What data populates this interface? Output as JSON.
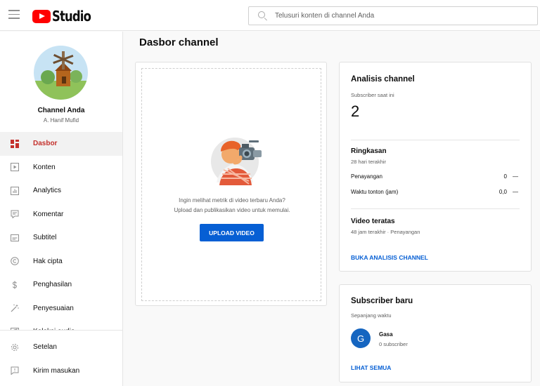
{
  "header": {
    "logo_text": "Studio",
    "search_placeholder": "Telusuri konten di channel Anda"
  },
  "sidebar": {
    "channel_name": "Channel Anda",
    "channel_owner": "A. Hanif Mufid",
    "items": [
      {
        "label": "Dasbor",
        "icon": "dashboard-icon",
        "active": true
      },
      {
        "label": "Konten",
        "icon": "content-icon"
      },
      {
        "label": "Analytics",
        "icon": "analytics-icon"
      },
      {
        "label": "Komentar",
        "icon": "comments-icon"
      },
      {
        "label": "Subtitel",
        "icon": "subtitles-icon"
      },
      {
        "label": "Hak cipta",
        "icon": "copyright-icon"
      },
      {
        "label": "Penghasilan",
        "icon": "monetization-icon"
      },
      {
        "label": "Penyesuaian",
        "icon": "customization-icon"
      },
      {
        "label": "Koleksi audio",
        "icon": "audio-library-icon"
      }
    ],
    "bottom_items": [
      {
        "label": "Setelan",
        "icon": "settings-icon"
      },
      {
        "label": "Kirim masukan",
        "icon": "feedback-icon"
      }
    ]
  },
  "main": {
    "page_title": "Dasbor channel",
    "upload_card": {
      "line1": "Ingin melihat metrik di video terbaru Anda?",
      "line2": "Upload dan publikasikan video untuk memulai.",
      "button": "UPLOAD VIDEO"
    },
    "analytics_card": {
      "title": "Analisis channel",
      "current_subs_label": "Subscriber saat ini",
      "current_subs": "2",
      "summary_title": "Ringkasan",
      "summary_period": "28 hari terakhir",
      "views_label": "Penayangan",
      "views_value": "0",
      "views_change": "—",
      "watch_label": "Waktu tonton (jam)",
      "watch_value": "0,0",
      "watch_change": "—",
      "top_videos_title": "Video teratas",
      "top_videos_period": "48 jam terakhir · Penayangan",
      "link": "BUKA ANALISIS CHANNEL"
    },
    "subs_card": {
      "title": "Subscriber baru",
      "period": "Sepanjang waktu",
      "subscriber_initial": "G",
      "subscriber_name": "Gasa",
      "subscriber_count": "0 subscriber",
      "link": "LIHAT SEMUA"
    }
  },
  "colors": {
    "brand_red": "#ff0000",
    "active_red": "#c4302b",
    "link_blue": "#065fd4"
  }
}
